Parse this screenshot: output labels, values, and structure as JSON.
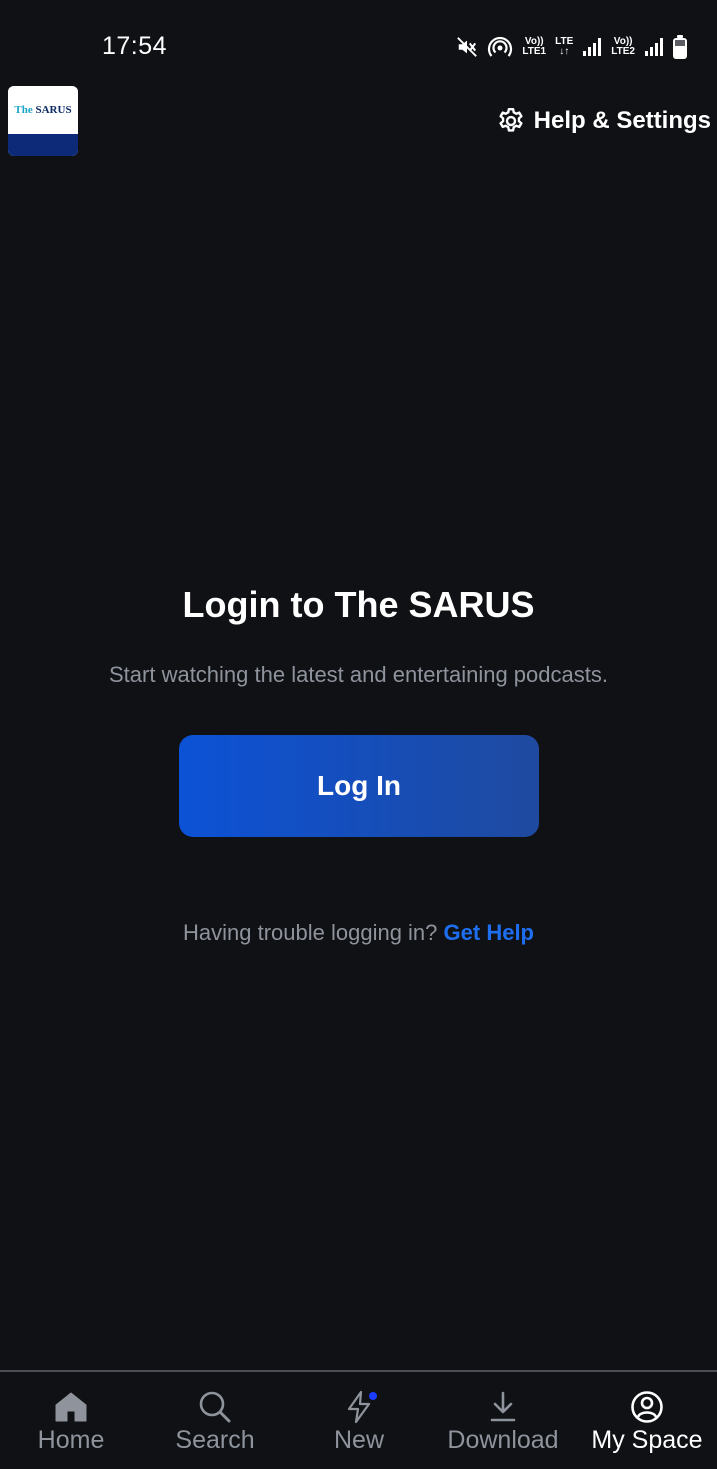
{
  "status_bar": {
    "time": "17:54",
    "icons": [
      "mute-icon",
      "hotspot-icon",
      "volte1-icon",
      "lte-icon",
      "signal1-icon",
      "volte2-icon",
      "signal2-icon",
      "battery-icon"
    ],
    "labels": {
      "volte1_top": "Vo))",
      "volte1_bottom": "LTE1",
      "lte_top": "LTE",
      "lte_bottom": "↓↑",
      "volte2_top": "Vo))",
      "volte2_bottom": "LTE2"
    }
  },
  "header": {
    "logo_the": "The",
    "logo_name": "SARUS",
    "help_settings_label": "Help & Settings",
    "help_settings_icon": "gear-icon"
  },
  "main": {
    "title": "Login to The SARUS",
    "subtitle": "Start watching the latest and entertaining podcasts.",
    "login_button_label": "Log In",
    "trouble_text": "Having trouble logging in?",
    "get_help_label": "Get Help"
  },
  "bottom_nav": {
    "items": [
      {
        "label": "Home",
        "icon": "home-icon"
      },
      {
        "label": "Search",
        "icon": "search-icon"
      },
      {
        "label": "New",
        "icon": "lightning-icon"
      },
      {
        "label": "Download",
        "icon": "download-icon"
      },
      {
        "label": "My Space",
        "icon": "profile-icon"
      }
    ],
    "active": "My Space"
  },
  "colors": {
    "background": "#0f1115",
    "accent": "#1e6ef0",
    "button_gradient_start": "#0c52d6",
    "button_gradient_end": "#1f4aa0",
    "muted_text": "#8e939c",
    "new_dot": "#1a3cff"
  }
}
